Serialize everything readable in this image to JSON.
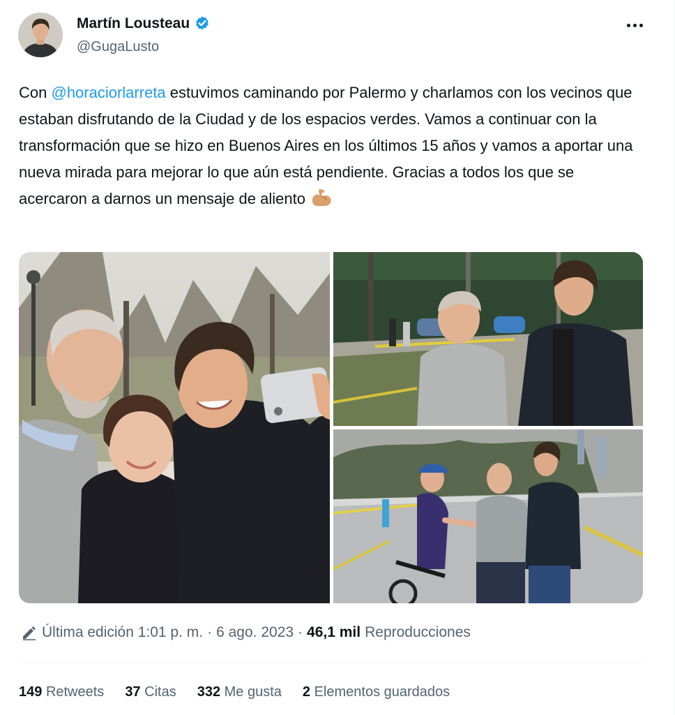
{
  "author": {
    "display_name": "Martín Lousteau",
    "handle": "@GugaLusto",
    "verified": true
  },
  "tweet": {
    "text_before": "Con ",
    "mention": "@horaciorlarreta",
    "text_after": " estuvimos caminando por Palermo y charlamos con los vecinos que estaban disfrutando de la Ciudad y de los espacios verdes. Vamos a continuar con la transformación que se hizo en Buenos Aires en los últimos 15 años y vamos a aportar una nueva mirada para mejorar lo que aún está pendiente. Gracias a todos los que se acercaron a darnos un mensaje de aliento",
    "emoji": "flexed-biceps-emoji"
  },
  "meta": {
    "edited": "Última edición 1:01 p. m.",
    "separator": "·",
    "date": "6 ago. 2023",
    "views_count": "46,1 mil",
    "views_label": "Reproducciones"
  },
  "stats": [
    {
      "count": "149",
      "label": "Retweets"
    },
    {
      "count": "37",
      "label": "Citas"
    },
    {
      "count": "332",
      "label": "Me gusta"
    },
    {
      "count": "2",
      "label": "Elementos guardados"
    }
  ],
  "colors": {
    "accent": "#1d9bf0",
    "text": "#0f1419",
    "secondary": "#536471",
    "divider": "#eff3f4"
  },
  "icons": [
    "verified-badge-icon",
    "more-options-icon",
    "edit-pencil-icon"
  ]
}
